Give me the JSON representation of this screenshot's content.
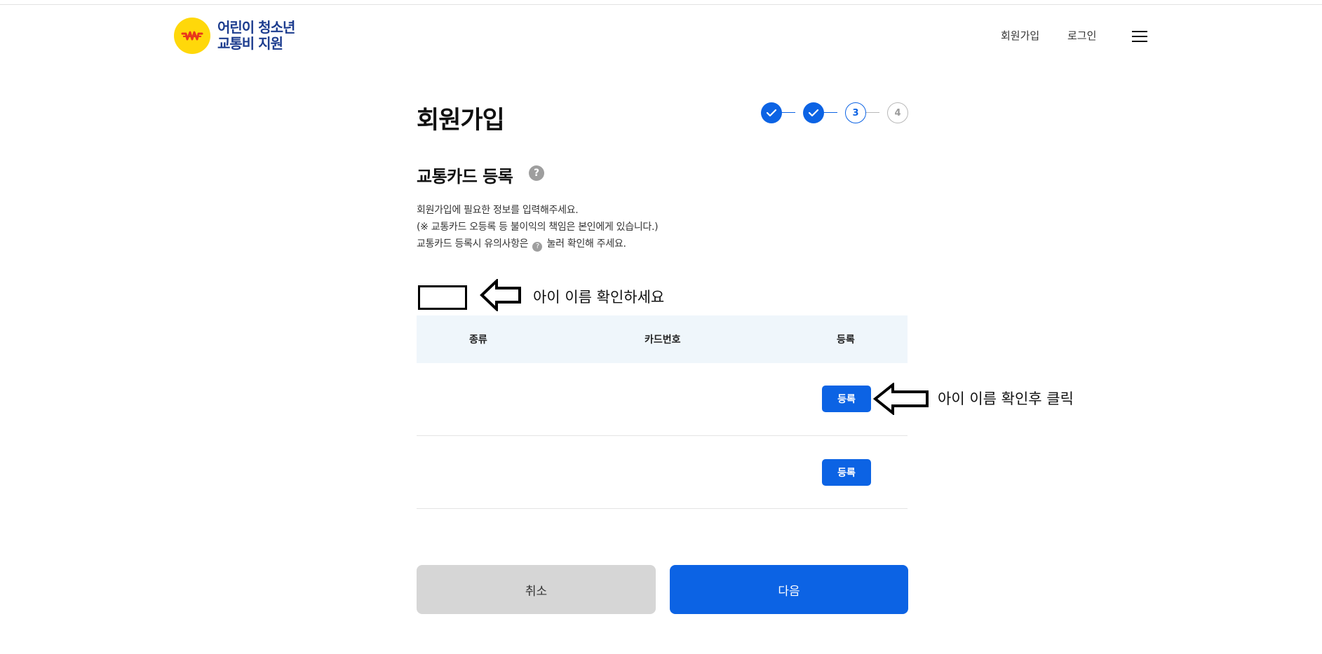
{
  "header": {
    "logo_line1": "어린이 청소년",
    "logo_line2": "교통비 지원",
    "nav": {
      "signup": "회원가입",
      "login": "로그인"
    }
  },
  "page": {
    "title": "회원가입",
    "steps": [
      {
        "label": "",
        "state": "done"
      },
      {
        "label": "",
        "state": "done"
      },
      {
        "label": "3",
        "state": "active"
      },
      {
        "label": "4",
        "state": "todo"
      }
    ]
  },
  "section": {
    "title": "교통카드 등록",
    "help_icon": "?",
    "desc_line1": "회원가입에 필요한 정보를 입력해주세요.",
    "desc_line2": "(※ 교통카드 오등록 등 불이익의 책임은 본인에게 있습니다.)",
    "desc_line3_pre": "교통카드 등록시 유의사항은",
    "desc_line3_icon": "?",
    "desc_line3_post": "눌러 확인해 주세요."
  },
  "annotations": {
    "name_check": "아이 이름 확인하세요",
    "click_after": "아이 이름 확인후 클릭"
  },
  "table": {
    "headers": {
      "type": "종류",
      "card_number": "카드번호",
      "register": "등록"
    },
    "rows": [
      {
        "type": "",
        "card_number": "",
        "button": "등록"
      },
      {
        "type": "",
        "card_number": "",
        "button": "등록"
      }
    ]
  },
  "actions": {
    "cancel": "취소",
    "next": "다음"
  },
  "colors": {
    "primary": "#0c63e4",
    "logo_yellow": "#ffd80a",
    "logo_text": "#1d3d8f",
    "header_bg": "#eff6fb"
  }
}
